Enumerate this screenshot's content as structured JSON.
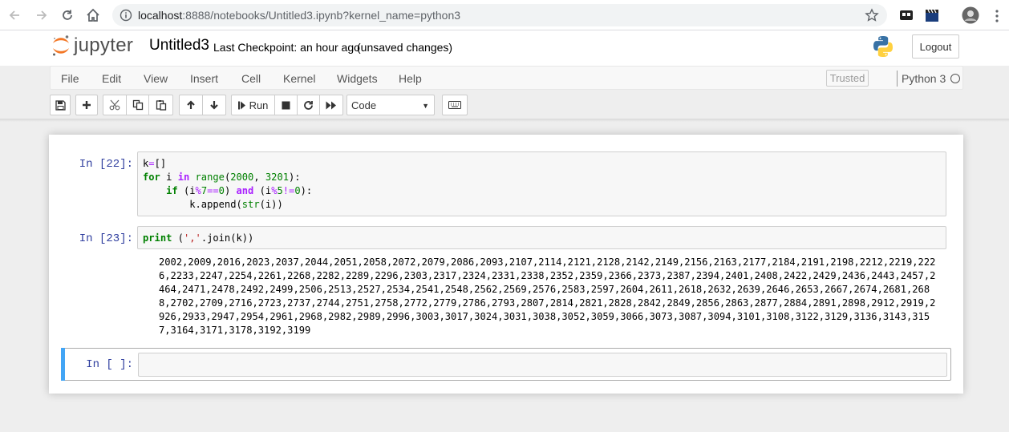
{
  "browser": {
    "url_host": "localhost",
    "url_rest": ":8888/notebooks/Untitled3.ipynb?kernel_name=python3"
  },
  "header": {
    "logo_text": "jupyter",
    "notebook_title": "Untitled3",
    "checkpoint": "Last Checkpoint: an hour ago",
    "unsaved": "(unsaved changes)",
    "logout": "Logout"
  },
  "menubar": {
    "items": [
      "File",
      "Edit",
      "View",
      "Insert",
      "Cell",
      "Kernel",
      "Widgets",
      "Help"
    ],
    "trusted": "Trusted",
    "kernel_name": "Python 3"
  },
  "toolbar": {
    "run_label": "Run",
    "cell_type": "Code"
  },
  "cells": [
    {
      "prompt": "In [22]:"
    },
    {
      "prompt": "In [23]:"
    },
    {
      "prompt": "In [ ]:"
    }
  ],
  "output": {
    "text": "2002,2009,2016,2023,2037,2044,2051,2058,2072,2079,2086,2093,2107,2114,2121,2128,2142,2149,2156,2163,2177,2184,2191,2198,2212,2219,2226,2233,2247,2254,2261,2268,2282,2289,2296,2303,2317,2324,2331,2338,2352,2359,2366,2373,2387,2394,2401,2408,2422,2429,2436,2443,2457,2464,2471,2478,2492,2499,2506,2513,2527,2534,2541,2548,2562,2569,2576,2583,2597,2604,2611,2618,2632,2639,2646,2653,2667,2674,2681,2688,2702,2709,2716,2723,2737,2744,2751,2758,2772,2779,2786,2793,2807,2814,2821,2828,2842,2849,2856,2863,2877,2884,2891,2898,2912,2919,2926,2933,2947,2954,2961,2968,2982,2989,2996,3003,3017,3024,3031,3038,3052,3059,3066,3073,3087,3094,3101,3108,3122,3129,3136,3143,3157,3164,3171,3178,3192,3199"
  },
  "colors": {
    "prompt_in": "#303f9f",
    "selected_cell_bar": "#42a5f5",
    "keyword": "#008000",
    "operator": "#aa22ff"
  },
  "icons": [
    "back-icon",
    "forward-icon",
    "reload-icon",
    "home-icon",
    "info-icon",
    "star-icon",
    "save-icon",
    "plus-icon",
    "cut-icon",
    "copy-icon",
    "paste-icon",
    "arrow-up-icon",
    "arrow-down-icon",
    "step-icon",
    "stop-icon",
    "restart-icon",
    "fast-forward-icon",
    "keyboard-icon"
  ]
}
